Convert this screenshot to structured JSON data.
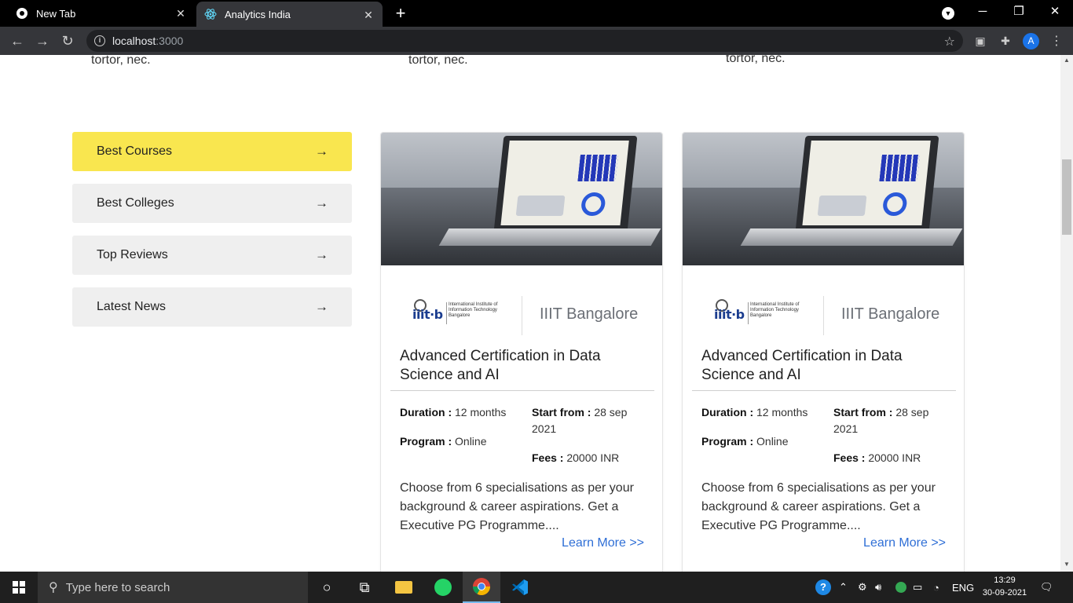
{
  "browser": {
    "tabs": [
      {
        "title": "New Tab",
        "active": false
      },
      {
        "title": "Analytics India",
        "active": true
      }
    ],
    "address": {
      "host": "localhost",
      "port": ":3000"
    },
    "profile_initial": "A"
  },
  "page": {
    "previous_section_fragments": [
      "tortor, nec.",
      "tortor, nec.",
      "tortor, nec."
    ],
    "sidebar": {
      "items": [
        {
          "label": "Best Courses",
          "active": true
        },
        {
          "label": "Best Colleges",
          "active": false
        },
        {
          "label": "Top Reviews",
          "active": false
        },
        {
          "label": "Latest News",
          "active": false
        }
      ],
      "arrow_glyph": "→"
    },
    "cards": [
      {
        "logo_mark": "iiit·b",
        "logo_sub": "International Institute of Information Technology Bangalore",
        "college": "IIIT Bangalore",
        "title": "Advanced Certification in Data Science and AI",
        "duration_label": "Duration :",
        "duration_value": "12 months",
        "program_label": "Program :",
        "program_value": "Online",
        "start_label": "Start from :",
        "start_value": "28 sep 2021",
        "fees_label": "Fees :",
        "fees_value": "20000 INR",
        "description": "Choose from 6 specialisations as per your background & career aspirations. Get a Executive PG Programme....",
        "learn_more": "Learn More >>"
      },
      {
        "logo_mark": "iiit·b",
        "logo_sub": "International Institute of Information Technology Bangalore",
        "college": "IIIT Bangalore",
        "title": "Advanced Certification in Data Science and AI",
        "duration_label": "Duration :",
        "duration_value": "12 months",
        "program_label": "Program :",
        "program_value": "Online",
        "start_label": "Start from :",
        "start_value": "28 sep 2021",
        "fees_label": "Fees :",
        "fees_value": "20000 INR",
        "description": "Choose from 6 specialisations as per your background & career aspirations. Get a Executive PG Programme....",
        "learn_more": "Learn More >>"
      }
    ]
  },
  "taskbar": {
    "search_placeholder": "Type here to search",
    "language": "ENG",
    "time": "13:29",
    "date": "30-09-2021"
  },
  "colors": {
    "active_sidebar": "#f9e64f",
    "link": "#2f6fd6",
    "avatar": "#1a73e8"
  }
}
